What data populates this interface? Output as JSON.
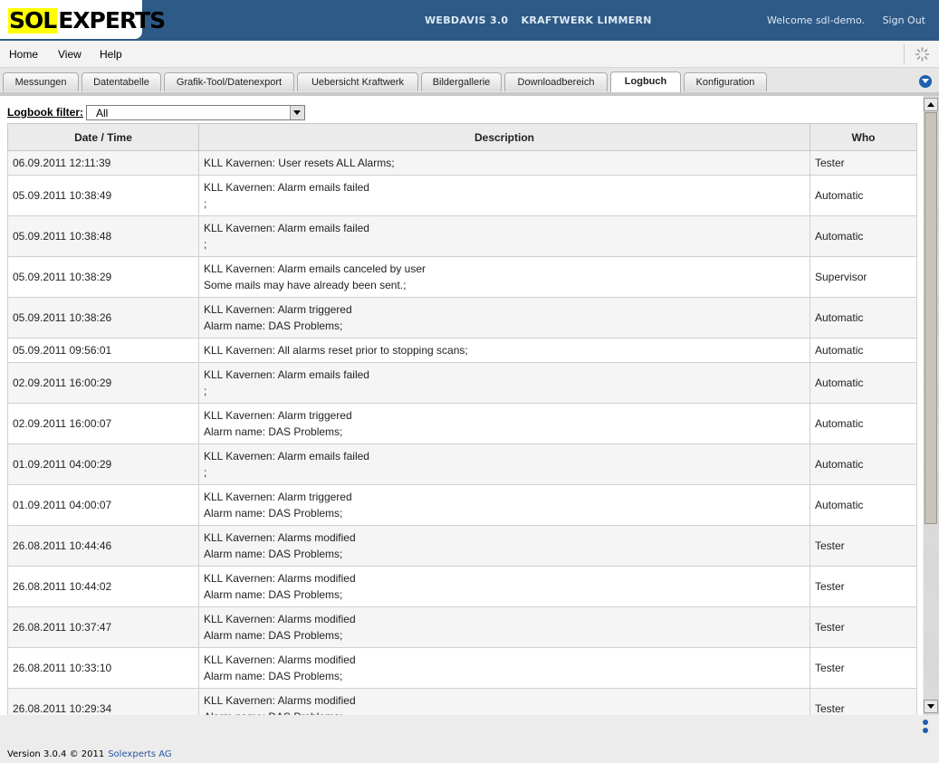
{
  "header": {
    "logo_part1": "SOL",
    "logo_part2": "EXPERTS",
    "app_name": "WEBDAVIS 3.0",
    "project": "KRAFTWERK LIMMERN",
    "welcome": "Welcome sdl-demo.",
    "signout": "Sign Out"
  },
  "menu": {
    "items": [
      "Home",
      "View",
      "Help"
    ]
  },
  "tabs": [
    {
      "label": "Messungen"
    },
    {
      "label": "Datentabelle"
    },
    {
      "label": "Grafik-Tool/Datenexport"
    },
    {
      "label": "Uebersicht Kraftwerk"
    },
    {
      "label": "Bildergallerie"
    },
    {
      "label": "Downloadbereich"
    },
    {
      "label": "Logbuch",
      "active": true
    },
    {
      "label": "Konfiguration"
    }
  ],
  "filter": {
    "label": "Logbook filter:",
    "value": "All"
  },
  "table": {
    "headers": [
      "Date / Time",
      "Description",
      "Who"
    ],
    "rows": [
      {
        "date": "06.09.2011 12:11:39",
        "desc": [
          "KLL Kavernen: User resets ALL Alarms;"
        ],
        "who": "Tester"
      },
      {
        "date": "05.09.2011 10:38:49",
        "desc": [
          "KLL Kavernen: Alarm emails failed",
          ";"
        ],
        "who": "Automatic"
      },
      {
        "date": "05.09.2011 10:38:48",
        "desc": [
          "KLL Kavernen: Alarm emails failed",
          ";"
        ],
        "who": "Automatic"
      },
      {
        "date": "05.09.2011 10:38:29",
        "desc": [
          "KLL Kavernen: Alarm emails canceled by user",
          "Some mails may have already been sent.;"
        ],
        "who": "Supervisor"
      },
      {
        "date": "05.09.2011 10:38:26",
        "desc": [
          "KLL Kavernen: Alarm triggered",
          "Alarm name: DAS Problems;"
        ],
        "who": "Automatic"
      },
      {
        "date": "05.09.2011 09:56:01",
        "desc": [
          "KLL Kavernen: All alarms reset prior to stopping scans;"
        ],
        "who": "Automatic"
      },
      {
        "date": "02.09.2011 16:00:29",
        "desc": [
          "KLL Kavernen: Alarm emails failed",
          ";"
        ],
        "who": "Automatic"
      },
      {
        "date": "02.09.2011 16:00:07",
        "desc": [
          "KLL Kavernen: Alarm triggered",
          "Alarm name: DAS Problems;"
        ],
        "who": "Automatic"
      },
      {
        "date": "01.09.2011 04:00:29",
        "desc": [
          "KLL Kavernen: Alarm emails failed",
          ";"
        ],
        "who": "Automatic"
      },
      {
        "date": "01.09.2011 04:00:07",
        "desc": [
          "KLL Kavernen: Alarm triggered",
          "Alarm name: DAS Problems;"
        ],
        "who": "Automatic"
      },
      {
        "date": "26.08.2011 10:44:46",
        "desc": [
          "KLL Kavernen: Alarms modified",
          "Alarm name: DAS Problems;"
        ],
        "who": "Tester"
      },
      {
        "date": "26.08.2011 10:44:02",
        "desc": [
          "KLL Kavernen: Alarms modified",
          "Alarm name: DAS Problems;"
        ],
        "who": "Tester"
      },
      {
        "date": "26.08.2011 10:37:47",
        "desc": [
          "KLL Kavernen: Alarms modified",
          "Alarm name: DAS Problems;"
        ],
        "who": "Tester"
      },
      {
        "date": "26.08.2011 10:33:10",
        "desc": [
          "KLL Kavernen: Alarms modified",
          "Alarm name: DAS Problems;"
        ],
        "who": "Tester"
      },
      {
        "date": "26.08.2011 10:29:34",
        "desc": [
          "KLL Kavernen: Alarms modified",
          "Alarm name: DAS Problems;"
        ],
        "who": "Tester"
      }
    ]
  },
  "footer": {
    "version": "Version 3.0.4 © 2011",
    "company": "Solexperts AG"
  },
  "icons": {
    "spinner": "loading-spinner-icon",
    "tab_menu": "chevron-down-circle-icon",
    "more": "more-dots-icon"
  },
  "colors": {
    "header_bg": "#2d5a87",
    "logo_highlight": "#ffff00",
    "accent": "#1f5fae"
  }
}
